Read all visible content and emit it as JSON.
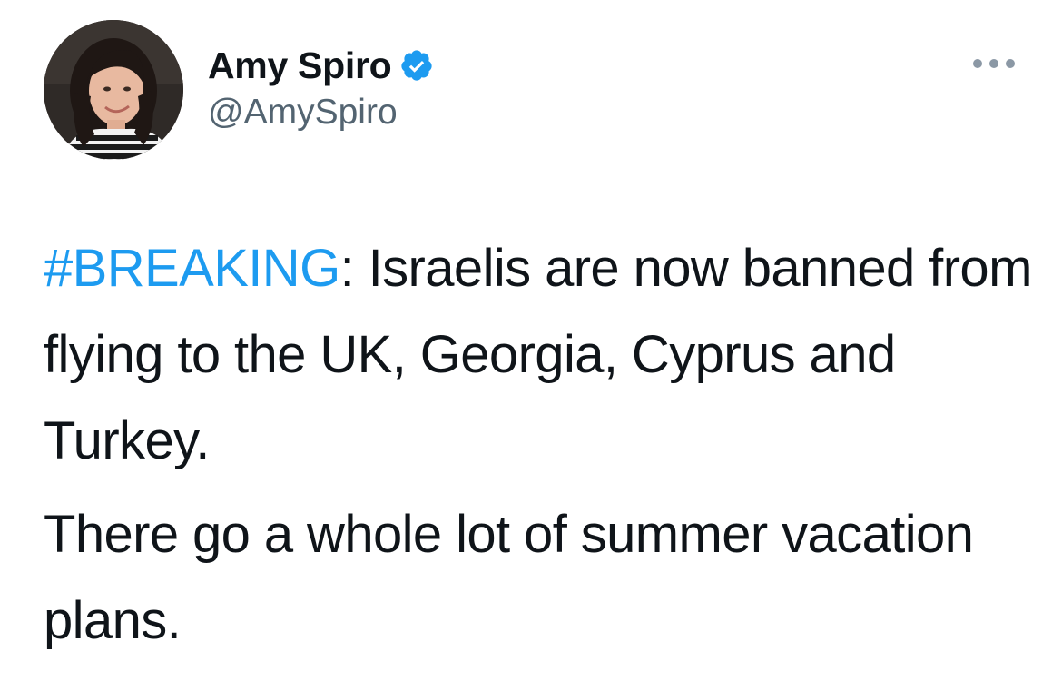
{
  "author": {
    "display_name": "Amy Spiro",
    "handle": "@AmySpiro",
    "verified": true
  },
  "tweet": {
    "hashtag": "#BREAKING",
    "para1_rest": ": Israelis are now banned from flying to the UK, Georgia, Cyprus and Turkey.",
    "para2": "There go a whole lot of summer vacation plans."
  },
  "icons": {
    "verified": "verified-badge-icon",
    "more": "more-options-icon"
  },
  "colors": {
    "hashtag": "#1d9bf0",
    "handle": "#536471",
    "text": "#0f1419",
    "verified": "#1d9bf0"
  }
}
